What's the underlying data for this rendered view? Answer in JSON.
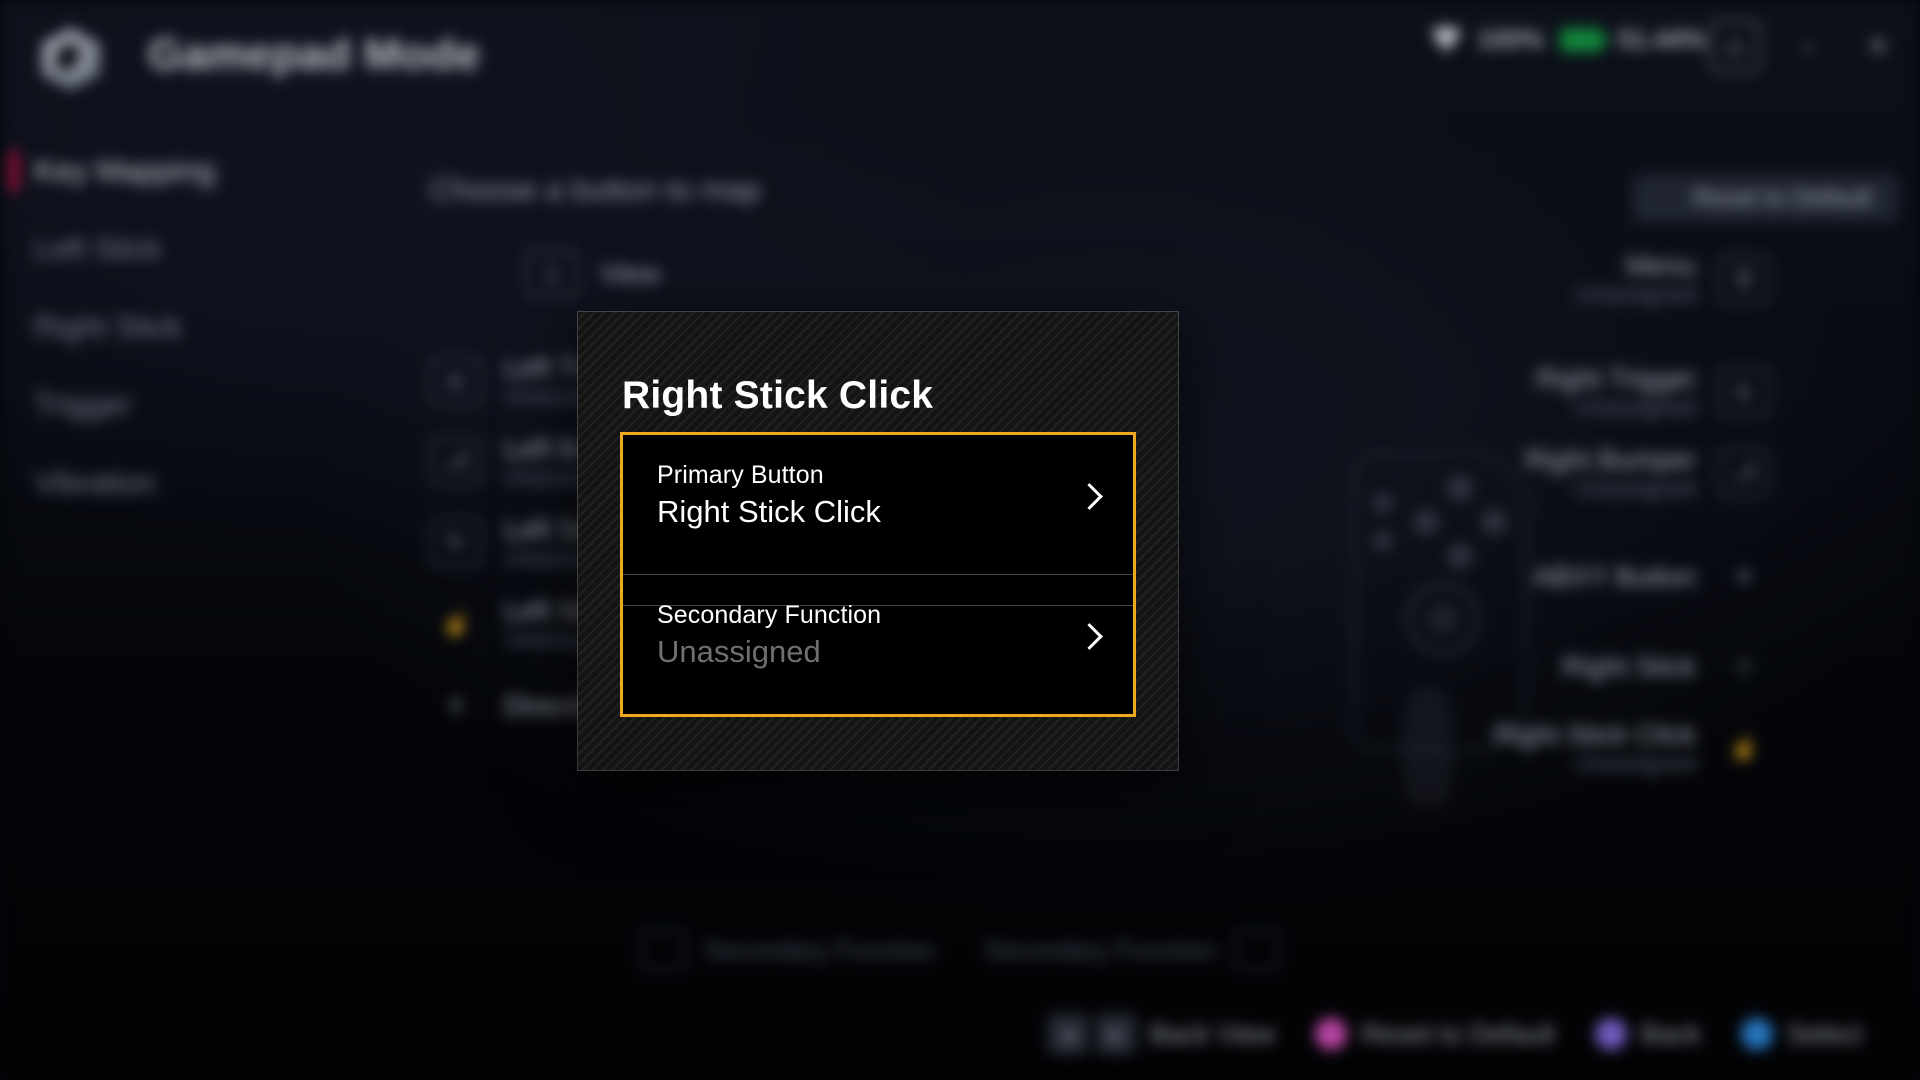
{
  "window": {
    "title": "Gamepad Mode",
    "logo_icon": "hexagon-logo-icon",
    "status": {
      "wifi_icon": "wifi-icon",
      "wifi_value": "100%",
      "battery_icon": "battery-icon",
      "battery_value": "51.44%",
      "battery_color": "#16a34a"
    },
    "controls": {
      "avatar_icon": "user-avatar-icon",
      "minimize_label": "–",
      "close_label": "✕"
    }
  },
  "sidebar": {
    "active_indicator_color": "#e01050",
    "items": [
      {
        "label": "Key Mapping",
        "active": true
      },
      {
        "label": "Left Stick",
        "active": false
      },
      {
        "label": "Right Stick",
        "active": false
      },
      {
        "label": "Trigger",
        "active": false
      },
      {
        "label": "Vibration",
        "active": false
      }
    ]
  },
  "content": {
    "heading": "Choose a button to map",
    "reset_button": "Reset to Default",
    "left_column": [
      {
        "glyph": "view-button-icon",
        "name": "View",
        "value": ""
      },
      {
        "glyph": "left-trigger-icon",
        "name": "Left Trigger",
        "value": "Unassigned"
      },
      {
        "glyph": "left-bumper-icon",
        "name": "Left Bumper",
        "value": "Unassigned"
      },
      {
        "glyph": "left-stick-icon",
        "name": "Left Stick",
        "value": "Unassigned"
      },
      {
        "glyph": "left-stick-click-icon",
        "name": "Left Stick Click",
        "value": "Unassigned"
      },
      {
        "glyph": "dpad-icon",
        "name": "Directional Pad",
        "value": ""
      }
    ],
    "right_column": [
      {
        "glyph": "menu-button-icon",
        "name": "Menu",
        "value": "Unassigned"
      },
      {
        "glyph": "right-trigger-icon",
        "name": "Right Trigger",
        "value": "Unassigned"
      },
      {
        "glyph": "right-bumper-icon",
        "name": "Right Bumper",
        "value": "Unassigned"
      },
      {
        "glyph": "abxy-icon",
        "name": "ABXY Button",
        "value": ""
      },
      {
        "glyph": "right-stick-icon",
        "name": "Right Stick",
        "value": ""
      },
      {
        "glyph": "right-stick-click-icon",
        "name": "Right Stick Click",
        "value": "Unassigned"
      }
    ],
    "secondary_hint_left": "Secondary Function",
    "secondary_hint_right": "Secondary Function"
  },
  "modal": {
    "title": "Right Stick Click",
    "border_color": "#f0a81e",
    "rows": [
      {
        "label": "Primary Button",
        "value": "Right Stick Click",
        "unassigned": false,
        "chevron": "chevron-right-icon"
      },
      {
        "label": "Secondary Function",
        "value": "Unassigned",
        "unassigned": true,
        "chevron": "chevron-right-icon"
      }
    ]
  },
  "bottombar": {
    "hints": [
      {
        "type": "keys",
        "keys": [
          "◂",
          "▸"
        ],
        "label": "Back View",
        "color": ""
      },
      {
        "type": "dot",
        "keys": [],
        "label": "Reset to Default",
        "color": "#e255c8"
      },
      {
        "type": "dot",
        "keys": [],
        "label": "Back",
        "color": "#8a6fe8"
      },
      {
        "type": "dot",
        "keys": [],
        "label": "Select",
        "color": "#2f8fe8"
      }
    ]
  }
}
